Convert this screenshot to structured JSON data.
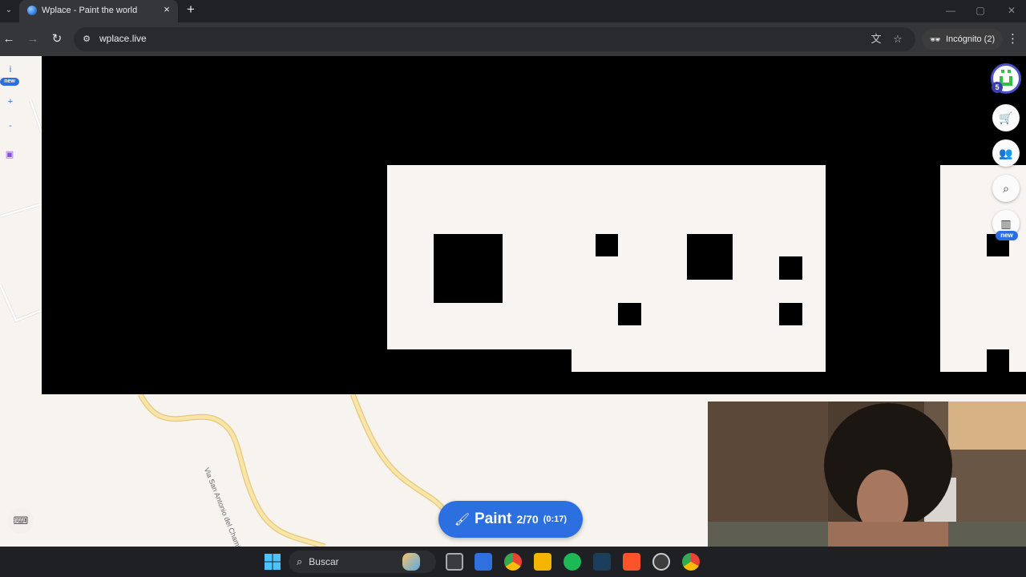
{
  "browser": {
    "tab_title": "Wplace - Paint the world",
    "tab_close": "×",
    "new_tab": "+",
    "url": "wplace.live",
    "incognito_label": "Incógnito (2)",
    "window_controls": {
      "minimize": "—",
      "maximize": "▢",
      "close": "✕"
    }
  },
  "map": {
    "street_labels": [
      "Via San Antonio del Chami - Río San Juan"
    ]
  },
  "left_controls": {
    "info": "i",
    "new_badge": "new",
    "zoom_in": "+",
    "zoom_out": "-"
  },
  "right_controls": {
    "level": "5",
    "new_badge": "new",
    "icons": [
      "cart-icon",
      "community-icon",
      "search-location-icon",
      "leaderboard-icon"
    ]
  },
  "paint_button": {
    "label": "Paint",
    "count": "2/70",
    "timer": "(0:17)"
  },
  "taskbar": {
    "search_label": "Buscar"
  },
  "colors": {
    "accent": "#2b6fe0",
    "canvas_black": "#000000",
    "canvas_white": "#f7f4f1",
    "road": "#f3dc96"
  }
}
